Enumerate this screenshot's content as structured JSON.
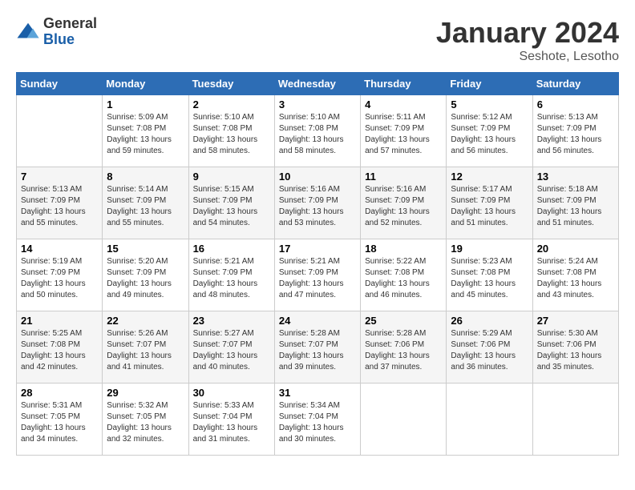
{
  "header": {
    "logo": {
      "general": "General",
      "blue": "Blue"
    },
    "title": "January 2024",
    "subtitle": "Seshote, Lesotho"
  },
  "days_of_week": [
    "Sunday",
    "Monday",
    "Tuesday",
    "Wednesday",
    "Thursday",
    "Friday",
    "Saturday"
  ],
  "weeks": [
    [
      {
        "num": "",
        "sunrise": "",
        "sunset": "",
        "daylight": "",
        "empty": true
      },
      {
        "num": "1",
        "sunrise": "Sunrise: 5:09 AM",
        "sunset": "Sunset: 7:08 PM",
        "daylight": "Daylight: 13 hours and 59 minutes."
      },
      {
        "num": "2",
        "sunrise": "Sunrise: 5:10 AM",
        "sunset": "Sunset: 7:08 PM",
        "daylight": "Daylight: 13 hours and 58 minutes."
      },
      {
        "num": "3",
        "sunrise": "Sunrise: 5:10 AM",
        "sunset": "Sunset: 7:08 PM",
        "daylight": "Daylight: 13 hours and 58 minutes."
      },
      {
        "num": "4",
        "sunrise": "Sunrise: 5:11 AM",
        "sunset": "Sunset: 7:09 PM",
        "daylight": "Daylight: 13 hours and 57 minutes."
      },
      {
        "num": "5",
        "sunrise": "Sunrise: 5:12 AM",
        "sunset": "Sunset: 7:09 PM",
        "daylight": "Daylight: 13 hours and 56 minutes."
      },
      {
        "num": "6",
        "sunrise": "Sunrise: 5:13 AM",
        "sunset": "Sunset: 7:09 PM",
        "daylight": "Daylight: 13 hours and 56 minutes."
      }
    ],
    [
      {
        "num": "7",
        "sunrise": "Sunrise: 5:13 AM",
        "sunset": "Sunset: 7:09 PM",
        "daylight": "Daylight: 13 hours and 55 minutes."
      },
      {
        "num": "8",
        "sunrise": "Sunrise: 5:14 AM",
        "sunset": "Sunset: 7:09 PM",
        "daylight": "Daylight: 13 hours and 55 minutes."
      },
      {
        "num": "9",
        "sunrise": "Sunrise: 5:15 AM",
        "sunset": "Sunset: 7:09 PM",
        "daylight": "Daylight: 13 hours and 54 minutes."
      },
      {
        "num": "10",
        "sunrise": "Sunrise: 5:16 AM",
        "sunset": "Sunset: 7:09 PM",
        "daylight": "Daylight: 13 hours and 53 minutes."
      },
      {
        "num": "11",
        "sunrise": "Sunrise: 5:16 AM",
        "sunset": "Sunset: 7:09 PM",
        "daylight": "Daylight: 13 hours and 52 minutes."
      },
      {
        "num": "12",
        "sunrise": "Sunrise: 5:17 AM",
        "sunset": "Sunset: 7:09 PM",
        "daylight": "Daylight: 13 hours and 51 minutes."
      },
      {
        "num": "13",
        "sunrise": "Sunrise: 5:18 AM",
        "sunset": "Sunset: 7:09 PM",
        "daylight": "Daylight: 13 hours and 51 minutes."
      }
    ],
    [
      {
        "num": "14",
        "sunrise": "Sunrise: 5:19 AM",
        "sunset": "Sunset: 7:09 PM",
        "daylight": "Daylight: 13 hours and 50 minutes."
      },
      {
        "num": "15",
        "sunrise": "Sunrise: 5:20 AM",
        "sunset": "Sunset: 7:09 PM",
        "daylight": "Daylight: 13 hours and 49 minutes."
      },
      {
        "num": "16",
        "sunrise": "Sunrise: 5:21 AM",
        "sunset": "Sunset: 7:09 PM",
        "daylight": "Daylight: 13 hours and 48 minutes."
      },
      {
        "num": "17",
        "sunrise": "Sunrise: 5:21 AM",
        "sunset": "Sunset: 7:09 PM",
        "daylight": "Daylight: 13 hours and 47 minutes."
      },
      {
        "num": "18",
        "sunrise": "Sunrise: 5:22 AM",
        "sunset": "Sunset: 7:08 PM",
        "daylight": "Daylight: 13 hours and 46 minutes."
      },
      {
        "num": "19",
        "sunrise": "Sunrise: 5:23 AM",
        "sunset": "Sunset: 7:08 PM",
        "daylight": "Daylight: 13 hours and 45 minutes."
      },
      {
        "num": "20",
        "sunrise": "Sunrise: 5:24 AM",
        "sunset": "Sunset: 7:08 PM",
        "daylight": "Daylight: 13 hours and 43 minutes."
      }
    ],
    [
      {
        "num": "21",
        "sunrise": "Sunrise: 5:25 AM",
        "sunset": "Sunset: 7:08 PM",
        "daylight": "Daylight: 13 hours and 42 minutes."
      },
      {
        "num": "22",
        "sunrise": "Sunrise: 5:26 AM",
        "sunset": "Sunset: 7:07 PM",
        "daylight": "Daylight: 13 hours and 41 minutes."
      },
      {
        "num": "23",
        "sunrise": "Sunrise: 5:27 AM",
        "sunset": "Sunset: 7:07 PM",
        "daylight": "Daylight: 13 hours and 40 minutes."
      },
      {
        "num": "24",
        "sunrise": "Sunrise: 5:28 AM",
        "sunset": "Sunset: 7:07 PM",
        "daylight": "Daylight: 13 hours and 39 minutes."
      },
      {
        "num": "25",
        "sunrise": "Sunrise: 5:28 AM",
        "sunset": "Sunset: 7:06 PM",
        "daylight": "Daylight: 13 hours and 37 minutes."
      },
      {
        "num": "26",
        "sunrise": "Sunrise: 5:29 AM",
        "sunset": "Sunset: 7:06 PM",
        "daylight": "Daylight: 13 hours and 36 minutes."
      },
      {
        "num": "27",
        "sunrise": "Sunrise: 5:30 AM",
        "sunset": "Sunset: 7:06 PM",
        "daylight": "Daylight: 13 hours and 35 minutes."
      }
    ],
    [
      {
        "num": "28",
        "sunrise": "Sunrise: 5:31 AM",
        "sunset": "Sunset: 7:05 PM",
        "daylight": "Daylight: 13 hours and 34 minutes."
      },
      {
        "num": "29",
        "sunrise": "Sunrise: 5:32 AM",
        "sunset": "Sunset: 7:05 PM",
        "daylight": "Daylight: 13 hours and 32 minutes."
      },
      {
        "num": "30",
        "sunrise": "Sunrise: 5:33 AM",
        "sunset": "Sunset: 7:04 PM",
        "daylight": "Daylight: 13 hours and 31 minutes."
      },
      {
        "num": "31",
        "sunrise": "Sunrise: 5:34 AM",
        "sunset": "Sunset: 7:04 PM",
        "daylight": "Daylight: 13 hours and 30 minutes."
      },
      {
        "num": "",
        "sunrise": "",
        "sunset": "",
        "daylight": "",
        "empty": true
      },
      {
        "num": "",
        "sunrise": "",
        "sunset": "",
        "daylight": "",
        "empty": true
      },
      {
        "num": "",
        "sunrise": "",
        "sunset": "",
        "daylight": "",
        "empty": true
      }
    ]
  ]
}
